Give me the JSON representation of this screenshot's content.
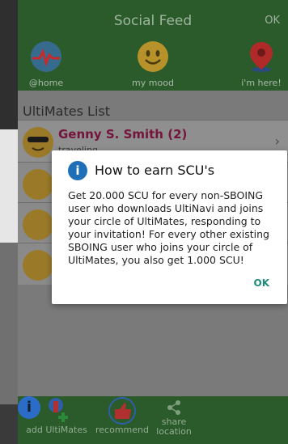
{
  "header": {
    "title": "Social Feed",
    "ok_label": "OK",
    "nav": [
      {
        "icon": "home-heartbeat-icon",
        "label": "@home"
      },
      {
        "icon": "smiley-icon",
        "label": "my mood"
      },
      {
        "icon": "location-pin-icon",
        "label": "i'm here!"
      }
    ]
  },
  "list": {
    "heading": "UltiMates List",
    "rows": [
      {
        "name": "Genny S. Smith (2)",
        "status": "traveling"
      }
    ]
  },
  "dialog": {
    "title": "How to earn SCU's",
    "body": "Get 20.000 SCU for every non-SBOING user who downloads UltiNavi and joins your circle of UltiMates, responding to your invitation! For every other existing SBOING user who joins your circle of UltiMates, you also get 1.000 SCU!",
    "ok": "OK"
  },
  "bottom": {
    "items": [
      {
        "icon": "add-user-icon",
        "label": "add UltiMates"
      },
      {
        "icon": "thumbs-up-icon",
        "label": "recommend"
      },
      {
        "icon": "share-icon",
        "label": "share location"
      },
      {
        "icon": "info-icon",
        "label": "i"
      }
    ]
  },
  "colors": {
    "primary_green": "#2b5a2b",
    "dialog_accent": "#1e8a7a",
    "info_blue": "#1e6fb8",
    "name_color": "#74143a"
  }
}
